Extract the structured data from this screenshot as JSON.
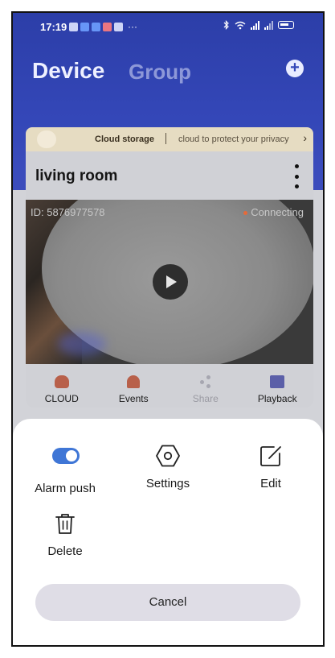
{
  "status_bar": {
    "time": "17:19",
    "overflow": "···"
  },
  "header": {
    "tab_device": "Device",
    "tab_group": "Group",
    "add_icon": "+"
  },
  "cloud_banner": {
    "title": "Cloud storage",
    "description": "cloud to protect your privacy",
    "chevron": "›"
  },
  "device_card": {
    "name": "living room",
    "video": {
      "id_text": "ID: 5876977578",
      "status_text": "Connecting",
      "status_color": "#e56a3a"
    },
    "actions": [
      {
        "label": "CLOUD",
        "icon": "cloud-icon"
      },
      {
        "label": "Events",
        "icon": "bell-icon"
      },
      {
        "label": "Share",
        "icon": "share-icon"
      },
      {
        "label": "Playback",
        "icon": "playback-icon"
      }
    ]
  },
  "sheet": {
    "alarm_push_label": "Alarm push",
    "alarm_push_enabled": true,
    "settings_label": "Settings",
    "edit_label": "Edit",
    "delete_label": "Delete",
    "cancel_label": "Cancel",
    "accent_color": "#3f76d6"
  }
}
